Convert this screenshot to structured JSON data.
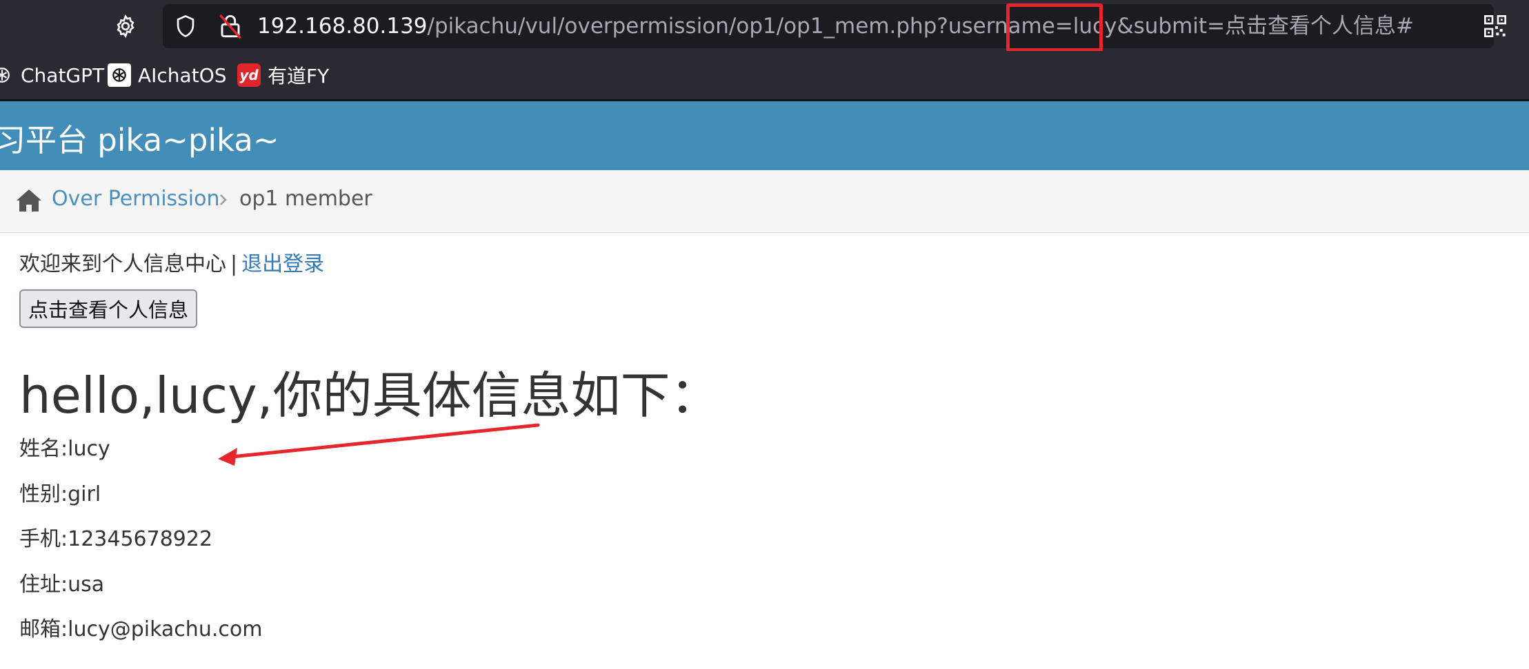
{
  "browser": {
    "url_host": "192.168.80.139",
    "url_path_before_highlight": "/pikachu/vul/overpermission/op1/op1_mem.php?usernam",
    "url_highlight": "e=lucy&s",
    "url_after_highlight": "ubmit=点击查看个人信息#"
  },
  "bookmarks": [
    {
      "label": "ChatGPT",
      "icon": "openai-icon"
    },
    {
      "label": "AIchatOS",
      "icon": "openai-icon"
    },
    {
      "label": "有道FY",
      "icon": "youdao-icon",
      "icon_text": "yd"
    }
  ],
  "site": {
    "title": "习平台 pika~pika~"
  },
  "breadcrumb": {
    "link": "Over Permission",
    "current": "op1 member"
  },
  "content": {
    "welcome": "欢迎来到个人信息中心",
    "separator": "|",
    "logout": "退出登录",
    "view_button": "点击查看个人信息",
    "hello": "hello,lucy,你的具体信息如下：",
    "info": [
      "姓名:lucy",
      "性别:girl",
      "手机:12345678922",
      "住址:usa",
      "邮箱:lucy@pikachu.com"
    ]
  },
  "colors": {
    "toolbar_bg": "#2b2a33",
    "header_blue": "#438eb9",
    "annotation_red": "#e5262c"
  }
}
